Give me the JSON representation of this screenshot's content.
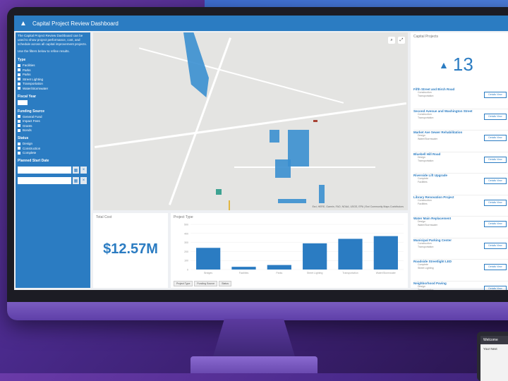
{
  "window": {
    "title": "Capital Project Review Dashboard"
  },
  "sidebar": {
    "intro": "The Capital Project Review Dashboard can be used to show project performance, cost, and schedule across all capital improvement projects.",
    "filter_hint": "Use the filters below to refine results.",
    "type_heading": "Type",
    "types": [
      "Facilities",
      "Parks",
      "Parks",
      "Street Lighting",
      "Transportation",
      "Water/Stormwater"
    ],
    "fiscal_year_heading": "Fiscal Year",
    "funding_heading": "Funding Source",
    "funding": [
      "General Fund",
      "Impact Fees",
      "Grants",
      "Bonds"
    ],
    "status_heading": "Status",
    "statuses": [
      "Design",
      "Construction",
      "Complete"
    ],
    "planned_start_heading": "Planned Start Date"
  },
  "map": {
    "attribution": "Esri, HERE, Garmin, FAO, NOAA, USGS, EPA | Esri Community Maps Contributors"
  },
  "total_cost": {
    "label": "Total Cost",
    "value": "$12.57M"
  },
  "chart": {
    "label": "Project Type",
    "tabs": [
      "Project Type",
      "Funding Source",
      "Status"
    ]
  },
  "chart_data": {
    "type": "bar",
    "title": "Project Type",
    "categories": [
      "Bridges",
      "Facilities",
      "Parks",
      "Street Lighting",
      "Transportation",
      "Water/Stormwater"
    ],
    "values": [
      240,
      30,
      50,
      290,
      340,
      370
    ],
    "ylim": [
      0,
      500
    ]
  },
  "projects": {
    "label": "Capital Projects",
    "count": "13",
    "button_label": "Details View",
    "items": [
      {
        "title": "Fifth Street and Birch Road",
        "line1": "Construction",
        "line2": "Transportation"
      },
      {
        "title": "Second Avenue and Washington Street",
        "line1": "Construction",
        "line2": "Transportation"
      },
      {
        "title": "Market Ave Sewer Rehabilitation",
        "line1": "Design",
        "line2": "Water/Stormwater"
      },
      {
        "title": "Bluebell Hill Road",
        "line1": "Design",
        "line2": "Transportation"
      },
      {
        "title": "Riverside Lift Upgrade",
        "line1": "Complete",
        "line2": "Facilities"
      },
      {
        "title": "Library Renovation Project",
        "line1": "Construction",
        "line2": "Facilities"
      },
      {
        "title": "Water Main Replacement",
        "line1": "Design",
        "line2": "Water/Stormwater"
      },
      {
        "title": "Municipal Parking Center",
        "line1": "Construction",
        "line2": "Transportation"
      },
      {
        "title": "Roadside Streetlight LED",
        "line1": "Complete",
        "line2": "Street Lighting"
      },
      {
        "title": "Neighborhood Paving",
        "line1": "Design",
        "line2": "Transportation"
      }
    ]
  },
  "device2": {
    "header": "Welcome",
    "text": "Your Next"
  }
}
